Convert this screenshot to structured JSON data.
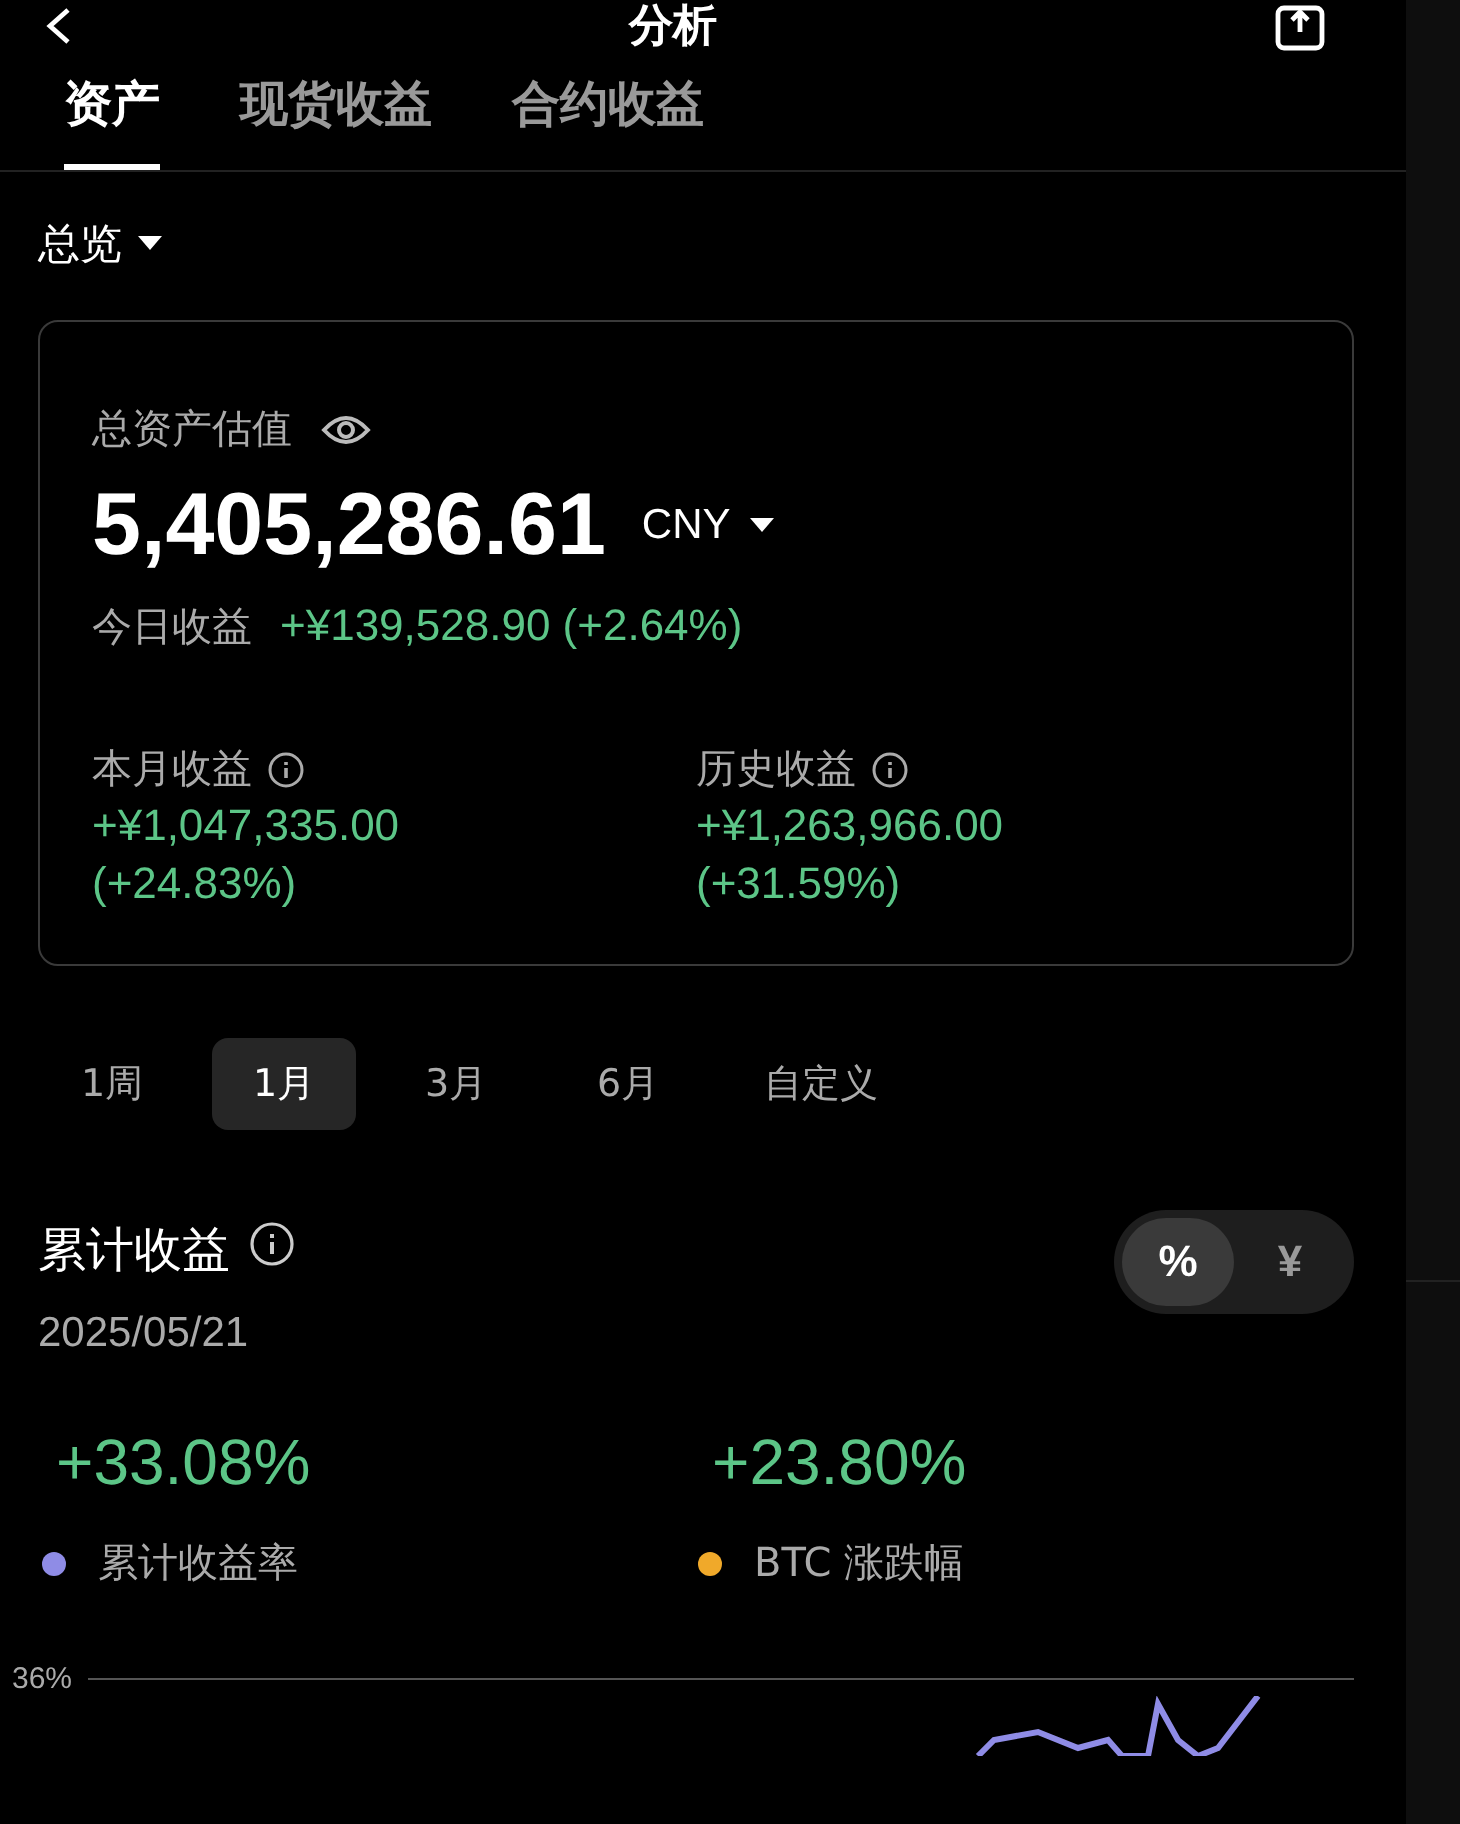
{
  "header": {
    "title": "分析"
  },
  "tabs": [
    {
      "label": "资产",
      "selected": true
    },
    {
      "label": "现货收益",
      "selected": false
    },
    {
      "label": "合约收益",
      "selected": false
    }
  ],
  "view_selector": {
    "label": "总览"
  },
  "asset_card": {
    "label": "总资产估值",
    "value": "5,405,286.61",
    "currency": "CNY",
    "today_label": "今日收益",
    "today_value": "+¥139,528.90 (+2.64%)",
    "stats": [
      {
        "label": "本月收益",
        "value": "+¥1,047,335.00",
        "change": "(+24.83%)"
      },
      {
        "label": "历史收益",
        "value": "+¥1,263,966.00",
        "change": "(+31.59%)"
      }
    ]
  },
  "periods": [
    {
      "label": "1周",
      "selected": false
    },
    {
      "label": "1月",
      "selected": true
    },
    {
      "label": "3月",
      "selected": false
    },
    {
      "label": "6月",
      "selected": false
    },
    {
      "label": "自定义",
      "selected": false
    }
  ],
  "cumulative": {
    "title": "累计收益",
    "date": "2025/05/21",
    "units": [
      {
        "label": "%",
        "selected": true
      },
      {
        "label": "¥",
        "selected": false
      }
    ],
    "metrics": [
      {
        "value": "+33.08%",
        "label": "累计收益率",
        "color": "#8f8ce6"
      },
      {
        "value": "+23.80%",
        "label": "BTC 涨跌幅",
        "color": "#f0a92a"
      }
    ],
    "axis_label": "36%"
  }
}
